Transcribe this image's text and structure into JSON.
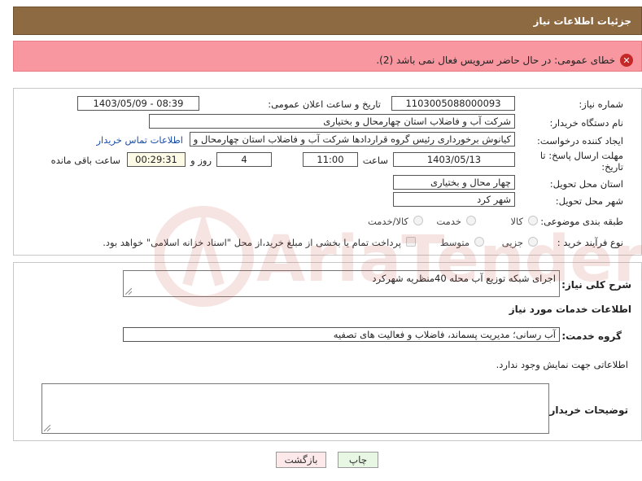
{
  "header": {
    "title": "جزئیات اطلاعات نیاز"
  },
  "error": {
    "text": "خطای عمومی: در حال حاضر سرویس فعال نمی باشد (2)."
  },
  "form": {
    "need_number_label": "شماره نیاز:",
    "need_number": "1103005088000093",
    "announce_label": "تاریخ و ساعت اعلان عمومی:",
    "announce_value": "1403/05/09 - 08:39",
    "buyer_org_label": "نام دستگاه خریدار:",
    "buyer_org": "شرکت آب و فاضلاب استان چهارمحال و بختیاری",
    "creator_label": "ایجاد کننده درخواست:",
    "creator": "کیانوش برخورداری رئیس گروه قراردادها شرکت آب و فاضلاب استان چهارمحال و",
    "contact_link": "اطلاعات تماس خریدار",
    "deadline_label": "مهلت ارسال پاسخ: تا تاریخ:",
    "deadline_date": "1403/05/13",
    "time_label": "ساعت",
    "deadline_time": "11:00",
    "days_value": "4",
    "days_label": "روز و",
    "remaining_time": "00:29:31",
    "remaining_label": "ساعت باقی مانده",
    "province_label": "استان محل تحویل:",
    "province": "چهار محال و بختیاری",
    "city_label": "شهر محل تحویل:",
    "city": "شهر کرد",
    "category_label": "طبقه بندی موضوعی:",
    "category_options": [
      "کالا",
      "خدمت",
      "کالا/خدمت"
    ],
    "process_label": "نوع فرآیند خرید :",
    "process_options": [
      "جزیی",
      "متوسط"
    ],
    "payment_note": "پرداخت تمام یا بخشی از مبلغ خرید،از محل \"اسناد خزانه اسلامی\" خواهد بود."
  },
  "details": {
    "summary_label": "شرح کلی نیاز:",
    "summary": "اجرای شبکه توزیع آب محله 40منظریه شهرکرد",
    "services_heading": "اطلاعات خدمات مورد نیاز",
    "service_group_label": "گروه خدمت:",
    "service_group": "آب رسانی؛ مدیریت پسماند، فاضلاب و فعالیت های تصفیه",
    "no_info": "اطلاعاتی جهت نمایش وجود ندارد.",
    "buyer_notes_label": "توضیحات خریدار:",
    "buyer_notes": ""
  },
  "buttons": {
    "back": "بازگشت",
    "print": "چاپ"
  },
  "watermark": {
    "text": "AriaTender.neT"
  },
  "colors": {
    "header_bg": "#8e6a42",
    "error_bg": "#f8979f",
    "link": "#1a4fa8"
  }
}
